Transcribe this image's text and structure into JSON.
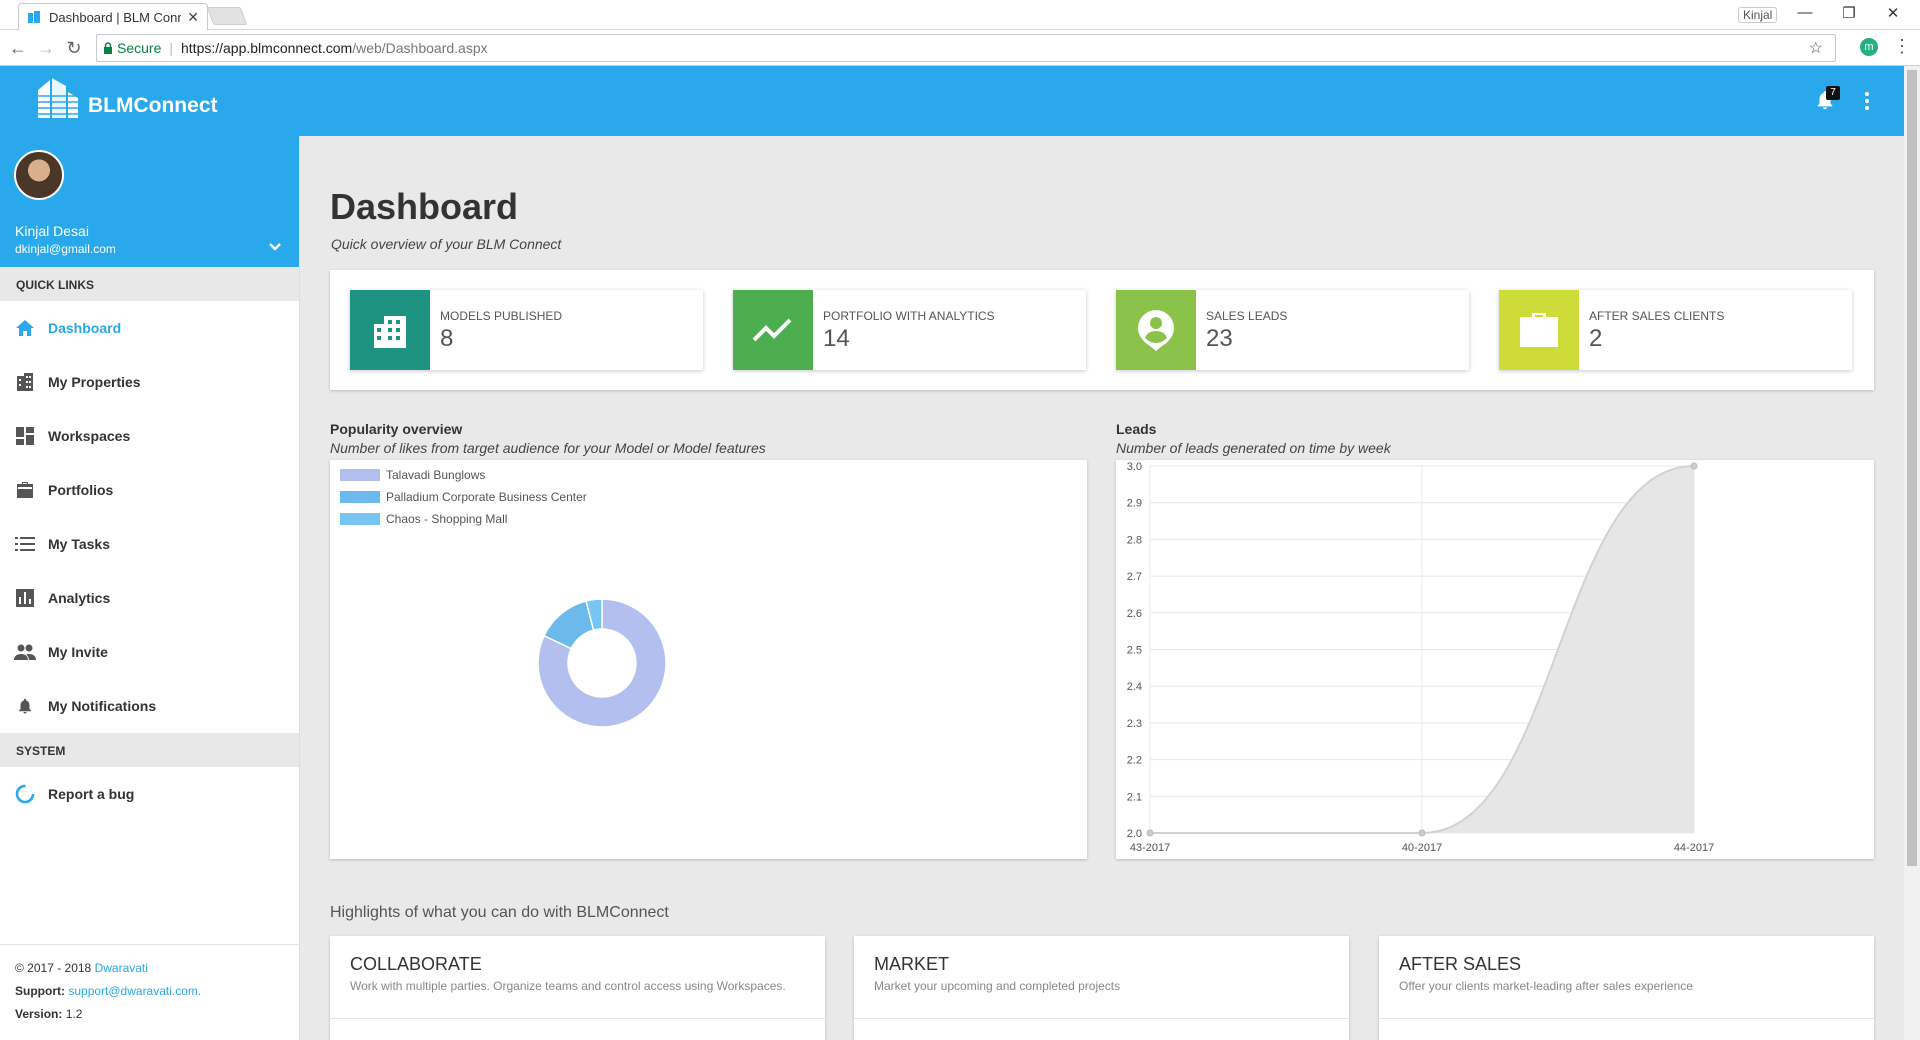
{
  "browser": {
    "tab_title": "Dashboard | BLM Connect",
    "tab_close": "✕",
    "profile_name": "Kinjal",
    "secure_label": "Secure",
    "url_host": "https://app.blmconnect.com",
    "url_path": "/web/Dashboard.aspx",
    "extension_letter": "m"
  },
  "header": {
    "brand": "BLMConnect",
    "notification_count": "7"
  },
  "user": {
    "name": "Kinjal Desai",
    "email": "dkinjal@gmail.com"
  },
  "sidebar": {
    "quick_links_heading": "QUICK LINKS",
    "items": [
      {
        "label": "Dashboard",
        "icon": "home-icon",
        "active": true
      },
      {
        "label": "My Properties",
        "icon": "building-icon"
      },
      {
        "label": "Workspaces",
        "icon": "dashboard-grid-icon"
      },
      {
        "label": "Portfolios",
        "icon": "briefcase-icon"
      },
      {
        "label": "My Tasks",
        "icon": "list-icon"
      },
      {
        "label": "Analytics",
        "icon": "bar-chart-icon"
      },
      {
        "label": "My Invite",
        "icon": "people-icon"
      },
      {
        "label": "My Notifications",
        "icon": "bell-icon"
      }
    ],
    "system_heading": "SYSTEM",
    "system_items": [
      {
        "label": "Report a bug",
        "icon": "loading-ring-icon"
      }
    ],
    "footer": {
      "copyright": "© 2017 - 2018",
      "company": "Dwaravati",
      "support_label": "Support:",
      "support_email": "support@dwaravati.com.",
      "version_label": "Version:",
      "version": "1.2"
    }
  },
  "page": {
    "title": "Dashboard",
    "subtitle": "Quick overview of your BLM Connect"
  },
  "stats": [
    {
      "label": "MODELS PUBLISHED",
      "value": "8",
      "color": "#1e9382",
      "icon": "city-building-icon"
    },
    {
      "label": "PORTFOLIO WITH ANALYTICS",
      "value": "14",
      "color": "#4cae4f",
      "icon": "trending-up-icon"
    },
    {
      "label": "SALES LEADS",
      "value": "23",
      "color": "#8bc34a",
      "icon": "person-pin-icon"
    },
    {
      "label": "AFTER SALES CLIENTS",
      "value": "2",
      "color": "#cddc39",
      "icon": "briefcase-icon"
    }
  ],
  "popularity": {
    "title": "Popularity overview",
    "subtitle": "Number of likes from target audience for your Model or Model features"
  },
  "leads": {
    "title": "Leads",
    "subtitle": "Number of leads generated on time by week"
  },
  "chart_data": [
    {
      "type": "pie",
      "legend_position": "top-left",
      "categories": [
        "Talavadi Bunglows",
        "Palladium Corporate Business Center",
        "Chaos - Shopping Mall"
      ],
      "values": [
        82,
        14,
        4
      ],
      "colors": [
        "#b3bfee",
        "#6cb9ec",
        "#78c4f2"
      ]
    },
    {
      "type": "area",
      "categories": [
        "43-2017",
        "40-2017",
        "44-2017"
      ],
      "values": [
        2.0,
        2.0,
        3.0
      ],
      "ylim": [
        2.0,
        3.0
      ],
      "yticks": [
        "3.0",
        "2.9",
        "2.8",
        "2.7",
        "2.6",
        "2.5",
        "2.4",
        "2.3",
        "2.2",
        "2.1",
        "2.0"
      ],
      "grid": true,
      "fill_color": "#e6e6e6",
      "line_color": "#d2d2d2"
    }
  ],
  "highlights": {
    "heading": "Highlights of what you can do with BLMConnect",
    "cards": [
      {
        "title": "COLLABORATE",
        "desc": "Work with multiple parties. Organize teams and control access using Workspaces."
      },
      {
        "title": "MARKET",
        "desc": "Market your upcoming and completed projects"
      },
      {
        "title": "AFTER SALES",
        "desc": "Offer your clients market-leading after sales experience"
      }
    ]
  }
}
